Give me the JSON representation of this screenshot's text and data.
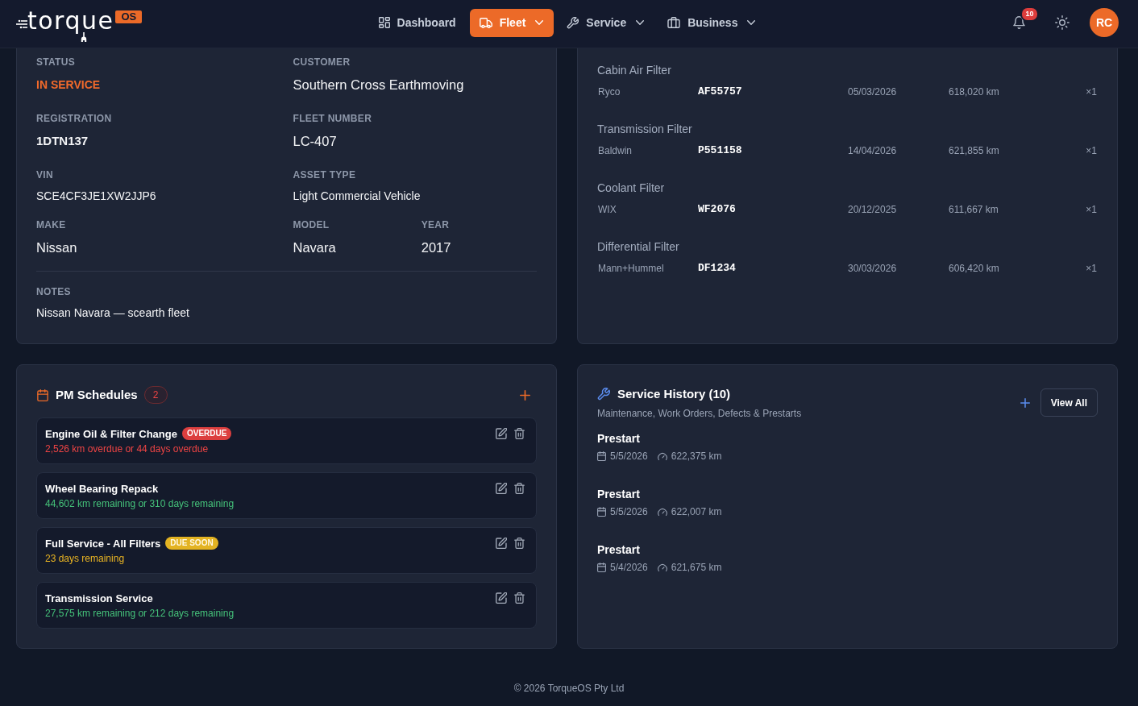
{
  "header": {
    "logo": {
      "wordmark": "torque",
      "badge": "OS"
    },
    "nav": [
      {
        "label": "Dashboard",
        "has_menu": false,
        "selected": false
      },
      {
        "label": "Fleet",
        "has_menu": true,
        "selected": true
      },
      {
        "label": "Service",
        "has_menu": true,
        "selected": false
      },
      {
        "label": "Business",
        "has_menu": true,
        "selected": false
      }
    ],
    "notification_count": "10",
    "avatar_initials": "RC"
  },
  "vehicle_details": {
    "rows": [
      [
        {
          "label": "STATUS",
          "value": "IN SERVICE",
          "kind": "status"
        },
        {
          "label": "CUSTOMER",
          "value": "Southern Cross Earthmoving",
          "kind": "large"
        }
      ],
      [
        {
          "label": "REGISTRATION",
          "value": "1DTN137",
          "kind": "bold"
        },
        {
          "label": "FLEET NUMBER",
          "value": "LC-407",
          "kind": "large"
        }
      ],
      [
        {
          "label": "VIN",
          "value": "SCE4CF3JE1XW2JJP6",
          "kind": "plain"
        },
        {
          "label": "ASSET TYPE",
          "value": "Light Commercial Vehicle",
          "kind": "plain"
        }
      ],
      [
        {
          "label": "MAKE",
          "value": "Nissan",
          "kind": "large"
        },
        {
          "label": "MODEL",
          "value": "Navara",
          "kind": "large"
        },
        {
          "label": "YEAR",
          "value": "2017",
          "kind": "large"
        }
      ]
    ],
    "notes": {
      "label": "NOTES",
      "value": "Nissan Navara — scearth fleet"
    }
  },
  "filters": [
    {
      "name": "Cabin Air Filter",
      "brand": "Ryco",
      "part_number": "AF55757",
      "date": "05/03/2026",
      "odometer": "618,020 km",
      "quantity": "×1"
    },
    {
      "name": "Transmission Filter",
      "brand": "Baldwin",
      "part_number": "P551158",
      "date": "14/04/2026",
      "odometer": "621,855 km",
      "quantity": "×1"
    },
    {
      "name": "Coolant Filter",
      "brand": "WIX",
      "part_number": "WF2076",
      "date": "20/12/2025",
      "odometer": "611,667 km",
      "quantity": "×1"
    },
    {
      "name": "Differential Filter",
      "brand": "Mann+Hummel",
      "part_number": "DF1234",
      "date": "30/03/2026",
      "odometer": "606,420 km",
      "quantity": "×1"
    }
  ],
  "pm_schedules": {
    "title": "PM Schedules",
    "count": "2",
    "items": [
      {
        "title": "Engine Oil & Filter Change",
        "badge": "OVERDUE",
        "kind": "overdue",
        "detail": "2,526 km overdue or 44 days overdue"
      },
      {
        "title": "Wheel Bearing Repack",
        "kind": "ok",
        "detail": "44,602 km remaining or 310 days remaining"
      },
      {
        "title": "Full Service - All Filters",
        "badge": "DUE SOON",
        "kind": "due_soon",
        "detail": "23 days remaining"
      },
      {
        "title": "Transmission Service",
        "kind": "ok",
        "detail": "27,575 km remaining or 212 days remaining"
      }
    ]
  },
  "service_history": {
    "title": "Service History (10)",
    "subtitle": "Maintenance, Work Orders, Defects & Prestarts",
    "action": "View All",
    "entries": [
      {
        "title": "Prestart",
        "date": "5/5/2026",
        "odometer": "622,375 km"
      },
      {
        "title": "Prestart",
        "date": "5/5/2026",
        "odometer": "622,007 km"
      },
      {
        "title": "Prestart",
        "date": "5/4/2026",
        "odometer": "621,675 km"
      }
    ]
  },
  "footer": "© 2026 TorqueOS Pty Ltd"
}
